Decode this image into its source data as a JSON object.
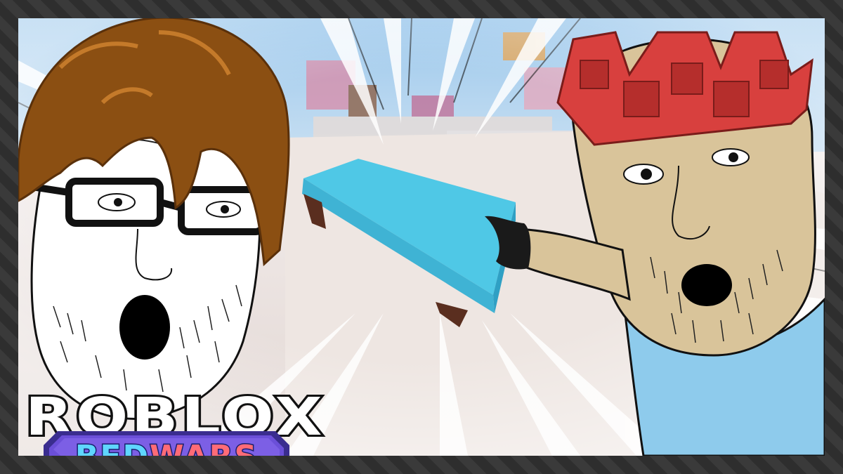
{
  "thumbnail": {
    "logo": {
      "roblox_text": "ROBLOX",
      "bed_text": "BED",
      "wars_text": "WARS"
    },
    "colors": {
      "bed_blue": "#4fc8e6",
      "wars_red": "#ff6b77",
      "badge_purple": "#6b4fd8",
      "crown_red": "#d8403e",
      "shirt_blue": "#8ecbec",
      "skin_tan": "#d9c49a",
      "hair_brown": "#8b4f12"
    },
    "icons": [
      "bed-icon",
      "crown-hat-icon",
      "hair-icon",
      "glasses-icon"
    ]
  }
}
